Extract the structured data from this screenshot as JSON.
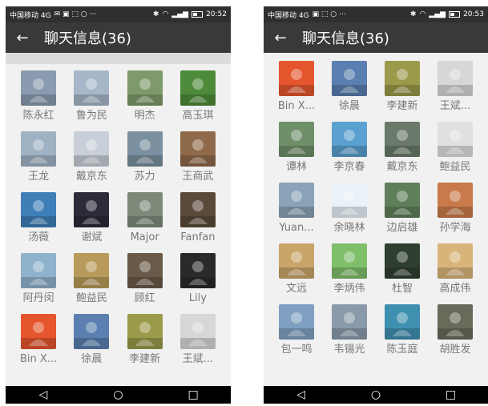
{
  "left": {
    "status": {
      "carrier": "中国移动 4G",
      "time": "20:52"
    },
    "title": "聊天信息(36)",
    "members": [
      {
        "name": "陈永红",
        "icon": "man-in-red-avatar",
        "bg": "#8a9bb0"
      },
      {
        "name": "鲁为民",
        "icon": "building-avatar",
        "bg": "#a7b7c9"
      },
      {
        "name": "明杰",
        "icon": "outdoor-person-avatar",
        "bg": "#7f9a6a"
      },
      {
        "name": "高玉琪",
        "icon": "sunflower-avatar",
        "bg": "#4d8a3a"
      },
      {
        "name": "王龙",
        "icon": "person-avatar",
        "bg": "#9fb2c4"
      },
      {
        "name": "戴京东",
        "icon": "person-outdoor-avatar",
        "bg": "#c8cfd8"
      },
      {
        "name": "苏力",
        "icon": "building-avatar",
        "bg": "#7a8f9f"
      },
      {
        "name": "王商武",
        "icon": "man-portrait-avatar",
        "bg": "#8f6a4a"
      },
      {
        "name": "汤薇",
        "icon": "sea-avatar",
        "bg": "#3f7fb8"
      },
      {
        "name": "谢斌",
        "icon": "city-night-avatar",
        "bg": "#2b2b3a"
      },
      {
        "name": "Major",
        "icon": "mountain-avatar",
        "bg": "#7d8a7a"
      },
      {
        "name": "Fanfan",
        "icon": "man-dark-avatar",
        "bg": "#5a4a3a"
      },
      {
        "name": "阿丹闵",
        "icon": "person-sea-avatar",
        "bg": "#8fb3cc"
      },
      {
        "name": "鲍益民",
        "icon": "cheetah-avatar",
        "bg": "#b89a5a"
      },
      {
        "name": "顾红",
        "icon": "man-glasses-avatar",
        "bg": "#6a5a4a"
      },
      {
        "name": "Lily",
        "icon": "colorful-art-avatar",
        "bg": "#2a2a2a"
      },
      {
        "name": "Bin X...",
        "icon": "red-logo-avatar",
        "bg": "#e5562e"
      },
      {
        "name": "徐晨",
        "icon": "landscape-tower-avatar",
        "bg": "#5a7fb0"
      },
      {
        "name": "李建新",
        "icon": "field-avatar",
        "bg": "#9a9a4a"
      },
      {
        "name": "王斌...",
        "icon": "man-red-shirt-avatar",
        "bg": "#d7d7d7"
      }
    ]
  },
  "right": {
    "status": {
      "carrier": "中国移动 4G",
      "time": "20:53"
    },
    "title": "聊天信息(36)",
    "members": [
      {
        "name": "Bin X...",
        "icon": "red-logo-avatar",
        "bg": "#e5562e"
      },
      {
        "name": "徐晨",
        "icon": "landscape-tower-avatar",
        "bg": "#5a7fb0"
      },
      {
        "name": "李建新",
        "icon": "field-avatar",
        "bg": "#9a9a4a"
      },
      {
        "name": "王斌...",
        "icon": "man-red-shirt-avatar",
        "bg": "#d7d7d7"
      },
      {
        "name": "谭林",
        "icon": "valley-avatar",
        "bg": "#6f8f6a"
      },
      {
        "name": "李京春",
        "icon": "cartoon-avatar",
        "bg": "#5aa0d0"
      },
      {
        "name": "戴京东",
        "icon": "person-outdoor-avatar",
        "bg": "#6a7a6a"
      },
      {
        "name": "鲍益民",
        "icon": "sketch-portrait-avatar",
        "bg": "#e0e0e0"
      },
      {
        "name": "Yuan...",
        "icon": "man-coast-avatar",
        "bg": "#8aa3b8"
      },
      {
        "name": "余晓林",
        "icon": "water-drop-avatar",
        "bg": "#e8f2f8"
      },
      {
        "name": "边启雄",
        "icon": "man-outdoor-avatar",
        "bg": "#5f7f5a"
      },
      {
        "name": "孙学海",
        "icon": "sunset-avatar",
        "bg": "#c87a4a"
      },
      {
        "name": "文远",
        "icon": "man-yellow-avatar",
        "bg": "#c9a56a"
      },
      {
        "name": "李炳伟",
        "icon": "man-green-bg-avatar",
        "bg": "#7fbf6a"
      },
      {
        "name": "杜智",
        "icon": "dark-forest-avatar",
        "bg": "#2f3f2f"
      },
      {
        "name": "高成伟",
        "icon": "desert-camel-avatar",
        "bg": "#d8b47a"
      },
      {
        "name": "包一鸣",
        "icon": "pier-avatar",
        "bg": "#7fa0c0"
      },
      {
        "name": "韦锡光",
        "icon": "road-avatar",
        "bg": "#8a9aaa"
      },
      {
        "name": "陈玉庭",
        "icon": "lake-avatar",
        "bg": "#3f8fb0"
      },
      {
        "name": "胡胜发",
        "icon": "group-people-avatar",
        "bg": "#6a6a5a"
      }
    ]
  }
}
